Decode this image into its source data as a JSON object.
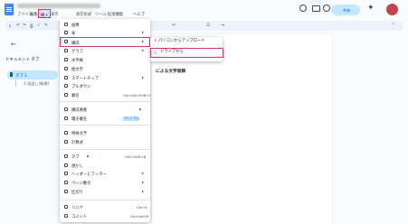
{
  "titlebar": {
    "menu": [
      "ファイル",
      "編集",
      "表示",
      "挿入",
      "表示形式",
      "ツール",
      "拡張機能",
      "ヘルプ"
    ],
    "share_label": "共有"
  },
  "toolbar": {
    "zoom": "100%",
    "style": "標準テキスト"
  },
  "left_panel": {
    "title": "ドキュメント タブ",
    "tab": "タブ 1",
    "outline_item": "1.見出し(新規)"
  },
  "document": {
    "visible_text": "による文字装飾"
  },
  "insert_menu": {
    "items": [
      {
        "label": "画像",
        "arrow": "▸"
      },
      {
        "label": "表",
        "arrow": "▸"
      },
      {
        "label": "構成",
        "arrow": "▸"
      },
      {
        "label": "グラフ",
        "arrow": "▸"
      },
      {
        "label": "水平線"
      },
      {
        "label": "絵文字"
      },
      {
        "label": "スマートチップ",
        "arrow": "▸"
      },
      {
        "label": "プルダウン"
      },
      {
        "label": "署名",
        "shortcut": "Ctrl+Alt+Shift+Y"
      },
      {
        "label": "構成要素"
      },
      {
        "label": "電子署名",
        "badge": "プレミアム"
      },
      {
        "label": "特殊文字"
      },
      {
        "label": "計算式"
      },
      {
        "label": "タブ",
        "shortcut": "Ctrl+Shift+N"
      },
      {
        "label": "透かし"
      },
      {
        "label": "ヘッダーとフッター",
        "arrow": "▸"
      },
      {
        "label": "ページ番号",
        "arrow": "▸"
      },
      {
        "label": "区切り",
        "arrow": "▸"
      },
      {
        "label": "リンク",
        "shortcut": "Ctrl+K"
      },
      {
        "label": "コメント",
        "shortcut": "Ctrl+Alt+M"
      }
    ]
  },
  "image_submenu": {
    "items": [
      "パソコンからアップロード",
      "ドライブから"
    ]
  }
}
